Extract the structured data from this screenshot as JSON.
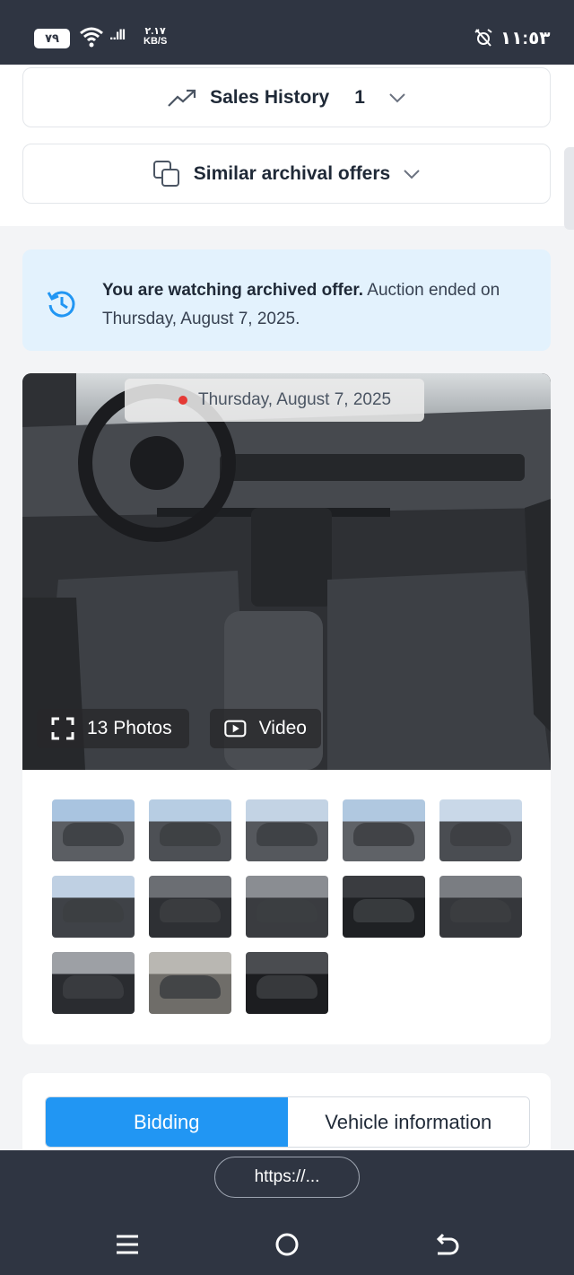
{
  "status_bar": {
    "battery": "٧٩",
    "net_speed_value": "٢.١٧",
    "net_speed_unit": "KB/S",
    "clock": "١١:٥٣",
    "signal": "..ıll"
  },
  "sales_history": {
    "label": "Sales History",
    "count": "1"
  },
  "similar_offers": {
    "label": "Similar archival offers"
  },
  "archived_notice": {
    "bold": "You are watching archived offer.",
    "text": " Auction ended on Thursday, August 7, 2025."
  },
  "gallery": {
    "date": "Thursday, August 7, 2025",
    "photos_label": "13 Photos",
    "video_label": "Video",
    "thumbnail_count": 13
  },
  "tabs": [
    {
      "label": "Bidding",
      "active": true
    },
    {
      "label": "Vehicle information",
      "active": false
    }
  ],
  "browser": {
    "url": "https://..."
  },
  "colors": {
    "accent": "#2196f3",
    "notice_bg": "#e3f2fd",
    "bar_bg": "#2f3542",
    "live_dot": "#e53935"
  }
}
